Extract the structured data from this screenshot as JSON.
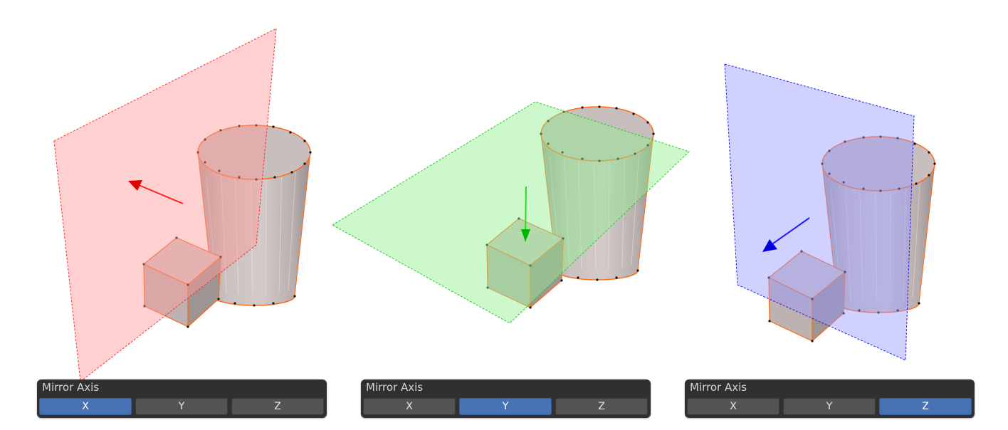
{
  "panels": [
    {
      "title": "Mirror Axis",
      "axes": [
        "X",
        "Y",
        "Z"
      ],
      "selected": "X"
    },
    {
      "title": "Mirror Axis",
      "axes": [
        "X",
        "Y",
        "Z"
      ],
      "selected": "Y"
    },
    {
      "title": "Mirror Axis",
      "axes": [
        "X",
        "Y",
        "Z"
      ],
      "selected": "Z"
    }
  ],
  "colors": {
    "x_axis": "#ff0000",
    "y_axis": "#00cc00",
    "z_axis": "#0000ff",
    "active_button": "#4772b3",
    "panel_bg": "#303030",
    "object_edge": "#ff6a1a"
  }
}
